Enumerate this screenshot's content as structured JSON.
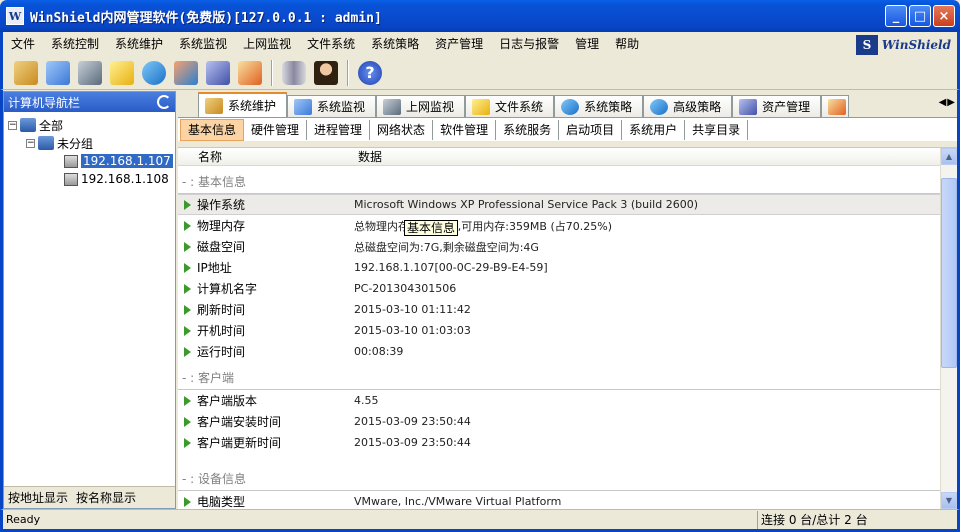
{
  "window": {
    "title": "WinShield内网管理软件(免费版)[127.0.0.1 : admin]",
    "app_icon": "W",
    "minimize": "_",
    "maximize": "□",
    "close": "×"
  },
  "menu": [
    "文件",
    "系统控制",
    "系统维护",
    "系统监视",
    "上网监视",
    "文件系统",
    "系统策略",
    "资产管理",
    "日志与报警",
    "管理",
    "帮助"
  ],
  "brand": {
    "logo": "S",
    "text": "WinShield"
  },
  "toolbar": {
    "icons": [
      {
        "name": "system-maintain-icon",
        "color": "#d8a040"
      },
      {
        "name": "system-monitor-icon",
        "color": "#4a8ae8"
      },
      {
        "name": "network-monitor-icon",
        "color": "#6a7a8a"
      },
      {
        "name": "file-system-icon",
        "color": "#f0c020"
      },
      {
        "name": "system-policy-icon",
        "color": "#2a8ad8"
      },
      {
        "name": "advanced-policy-icon",
        "color": "#e05040"
      },
      {
        "name": "asset-manage-icon",
        "color": "#5a6ab8"
      },
      {
        "name": "alarm-icon",
        "color": "#e08030"
      },
      {
        "name": "database-icon",
        "color": "#a0a0a8"
      },
      {
        "name": "user-icon",
        "color": "#403020"
      },
      {
        "name": "help-icon",
        "color": "#2050c8"
      }
    ],
    "help_label": "?"
  },
  "left_pane": {
    "header": "计算机导航栏",
    "tree": {
      "root": "全部",
      "group": "未分组",
      "hosts": [
        "192.168.1.107",
        "192.168.1.108"
      ]
    },
    "bottom_tabs": [
      "按地址显示",
      "按名称显示"
    ]
  },
  "tabs": [
    "系统维护",
    "系统监视",
    "上网监视",
    "文件系统",
    "系统策略",
    "高级策略",
    "资产管理"
  ],
  "subtabs": [
    "基本信息",
    "硬件管理",
    "进程管理",
    "网络状态",
    "软件管理",
    "系统服务",
    "启动项目",
    "系统用户",
    "共享目录"
  ],
  "grid": {
    "columns": [
      "名称",
      "数据"
    ],
    "groups": [
      {
        "title": "- : 基本信息",
        "rows": [
          {
            "name": "操作系统",
            "value": "Microsoft Windows XP Professional Service Pack 3 (build 2600)"
          },
          {
            "name": "物理内存",
            "value": "总物理内存:1023MB,可用内存:359MB (占70.25%)"
          },
          {
            "name": "磁盘空间",
            "value": "总磁盘空间为:7G,剩余磁盘空间为:4G"
          },
          {
            "name": "IP地址",
            "value": "192.168.1.107[00-0C-29-B9-E4-59]"
          },
          {
            "name": "计算机名字",
            "value": "PC-201304301506"
          },
          {
            "name": "刷新时间",
            "value": "2015-03-10 01:11:42"
          },
          {
            "name": "开机时间",
            "value": "2015-03-10 01:03:03"
          },
          {
            "name": "运行时间",
            "value": "00:08:39"
          }
        ]
      },
      {
        "title": "- : 客户端",
        "rows": [
          {
            "name": "客户端版本",
            "value": "4.55"
          },
          {
            "name": "客户端安装时间",
            "value": "2015-03-09 23:50:44"
          },
          {
            "name": "客户端更新时间",
            "value": "2015-03-09 23:50:44"
          }
        ]
      },
      {
        "title": "- : 设备信息",
        "rows": [
          {
            "name": "电脑类型",
            "value": "VMware, Inc./VMware Virtual Platform"
          }
        ]
      }
    ],
    "tooltip": "基本信息"
  },
  "status": {
    "left": "Ready",
    "connection": "连接 0 台/总计 2 台"
  }
}
